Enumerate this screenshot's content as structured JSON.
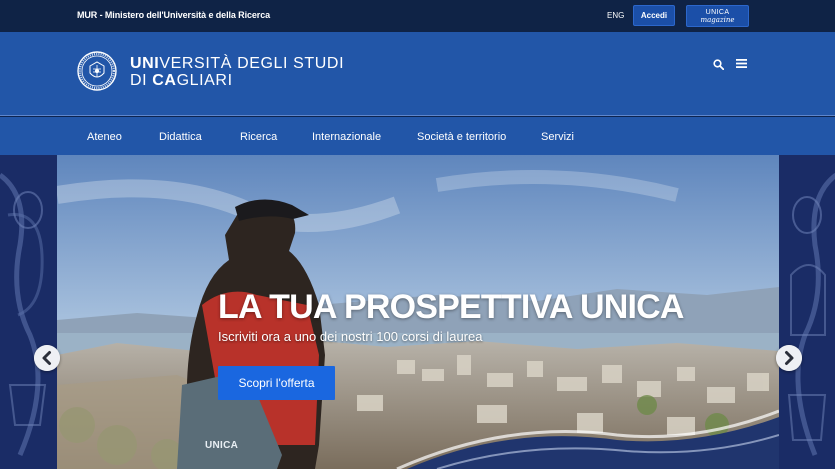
{
  "topbar": {
    "mur_link": "MUR - Ministero dell'Università e della Ricerca",
    "lang": "ENG",
    "login": "Accedi",
    "magazine_brand": "UNICA",
    "magazine_word": "magazine"
  },
  "header": {
    "name_line1_bold": "UNI",
    "name_line1_rest": "VERSITÀ DEGLI STUDI",
    "name_line2_pre": "DI ",
    "name_line2_bold": "CA",
    "name_line2_rest": "GLIARI"
  },
  "nav": {
    "items": [
      "Ateneo",
      "Didattica",
      "Ricerca",
      "Internazionale",
      "Società e territorio",
      "Servizi"
    ]
  },
  "hero": {
    "title": "LA TUA PROSPETTIVA UNICA",
    "subtitle": "Iscriviti ora a uno dei nostri 100 corsi di laurea",
    "cta": "Scopri l'offerta",
    "bag_text": "UNICA"
  },
  "colors": {
    "topbar": "#0f2346",
    "header": "#2256a8",
    "cta": "#1a67e0"
  },
  "icons": {
    "search": "search-icon",
    "menu": "hamburger-menu-icon",
    "prev": "chevron-left-icon",
    "next": "chevron-right-icon"
  }
}
